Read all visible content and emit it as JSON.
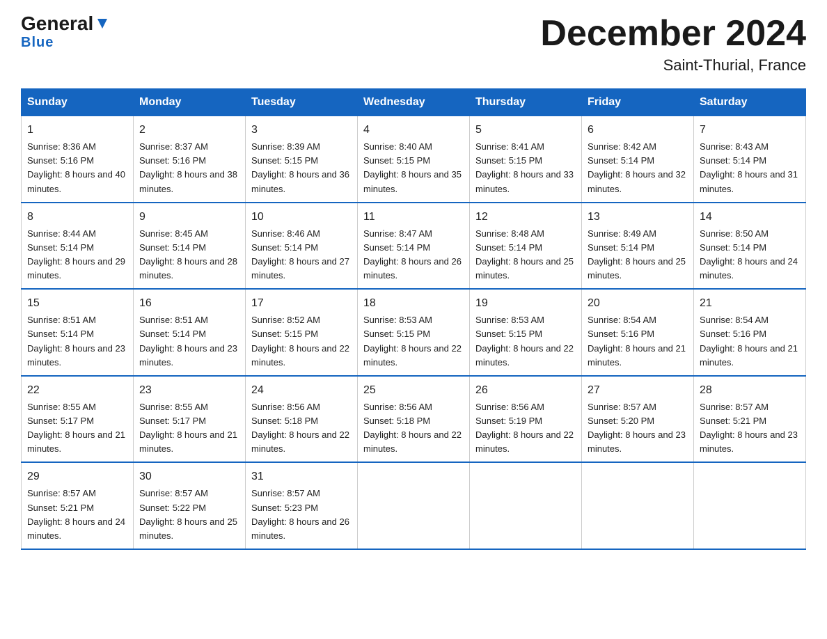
{
  "logo": {
    "general": "General",
    "blue": "Blue"
  },
  "title": "December 2024",
  "subtitle": "Saint-Thurial, France",
  "days_of_week": [
    "Sunday",
    "Monday",
    "Tuesday",
    "Wednesday",
    "Thursday",
    "Friday",
    "Saturday"
  ],
  "weeks": [
    [
      {
        "day": "1",
        "sunrise": "8:36 AM",
        "sunset": "5:16 PM",
        "daylight": "8 hours and 40 minutes."
      },
      {
        "day": "2",
        "sunrise": "8:37 AM",
        "sunset": "5:16 PM",
        "daylight": "8 hours and 38 minutes."
      },
      {
        "day": "3",
        "sunrise": "8:39 AM",
        "sunset": "5:15 PM",
        "daylight": "8 hours and 36 minutes."
      },
      {
        "day": "4",
        "sunrise": "8:40 AM",
        "sunset": "5:15 PM",
        "daylight": "8 hours and 35 minutes."
      },
      {
        "day": "5",
        "sunrise": "8:41 AM",
        "sunset": "5:15 PM",
        "daylight": "8 hours and 33 minutes."
      },
      {
        "day": "6",
        "sunrise": "8:42 AM",
        "sunset": "5:14 PM",
        "daylight": "8 hours and 32 minutes."
      },
      {
        "day": "7",
        "sunrise": "8:43 AM",
        "sunset": "5:14 PM",
        "daylight": "8 hours and 31 minutes."
      }
    ],
    [
      {
        "day": "8",
        "sunrise": "8:44 AM",
        "sunset": "5:14 PM",
        "daylight": "8 hours and 29 minutes."
      },
      {
        "day": "9",
        "sunrise": "8:45 AM",
        "sunset": "5:14 PM",
        "daylight": "8 hours and 28 minutes."
      },
      {
        "day": "10",
        "sunrise": "8:46 AM",
        "sunset": "5:14 PM",
        "daylight": "8 hours and 27 minutes."
      },
      {
        "day": "11",
        "sunrise": "8:47 AM",
        "sunset": "5:14 PM",
        "daylight": "8 hours and 26 minutes."
      },
      {
        "day": "12",
        "sunrise": "8:48 AM",
        "sunset": "5:14 PM",
        "daylight": "8 hours and 25 minutes."
      },
      {
        "day": "13",
        "sunrise": "8:49 AM",
        "sunset": "5:14 PM",
        "daylight": "8 hours and 25 minutes."
      },
      {
        "day": "14",
        "sunrise": "8:50 AM",
        "sunset": "5:14 PM",
        "daylight": "8 hours and 24 minutes."
      }
    ],
    [
      {
        "day": "15",
        "sunrise": "8:51 AM",
        "sunset": "5:14 PM",
        "daylight": "8 hours and 23 minutes."
      },
      {
        "day": "16",
        "sunrise": "8:51 AM",
        "sunset": "5:14 PM",
        "daylight": "8 hours and 23 minutes."
      },
      {
        "day": "17",
        "sunrise": "8:52 AM",
        "sunset": "5:15 PM",
        "daylight": "8 hours and 22 minutes."
      },
      {
        "day": "18",
        "sunrise": "8:53 AM",
        "sunset": "5:15 PM",
        "daylight": "8 hours and 22 minutes."
      },
      {
        "day": "19",
        "sunrise": "8:53 AM",
        "sunset": "5:15 PM",
        "daylight": "8 hours and 22 minutes."
      },
      {
        "day": "20",
        "sunrise": "8:54 AM",
        "sunset": "5:16 PM",
        "daylight": "8 hours and 21 minutes."
      },
      {
        "day": "21",
        "sunrise": "8:54 AM",
        "sunset": "5:16 PM",
        "daylight": "8 hours and 21 minutes."
      }
    ],
    [
      {
        "day": "22",
        "sunrise": "8:55 AM",
        "sunset": "5:17 PM",
        "daylight": "8 hours and 21 minutes."
      },
      {
        "day": "23",
        "sunrise": "8:55 AM",
        "sunset": "5:17 PM",
        "daylight": "8 hours and 21 minutes."
      },
      {
        "day": "24",
        "sunrise": "8:56 AM",
        "sunset": "5:18 PM",
        "daylight": "8 hours and 22 minutes."
      },
      {
        "day": "25",
        "sunrise": "8:56 AM",
        "sunset": "5:18 PM",
        "daylight": "8 hours and 22 minutes."
      },
      {
        "day": "26",
        "sunrise": "8:56 AM",
        "sunset": "5:19 PM",
        "daylight": "8 hours and 22 minutes."
      },
      {
        "day": "27",
        "sunrise": "8:57 AM",
        "sunset": "5:20 PM",
        "daylight": "8 hours and 23 minutes."
      },
      {
        "day": "28",
        "sunrise": "8:57 AM",
        "sunset": "5:21 PM",
        "daylight": "8 hours and 23 minutes."
      }
    ],
    [
      {
        "day": "29",
        "sunrise": "8:57 AM",
        "sunset": "5:21 PM",
        "daylight": "8 hours and 24 minutes."
      },
      {
        "day": "30",
        "sunrise": "8:57 AM",
        "sunset": "5:22 PM",
        "daylight": "8 hours and 25 minutes."
      },
      {
        "day": "31",
        "sunrise": "8:57 AM",
        "sunset": "5:23 PM",
        "daylight": "8 hours and 26 minutes."
      },
      null,
      null,
      null,
      null
    ]
  ]
}
